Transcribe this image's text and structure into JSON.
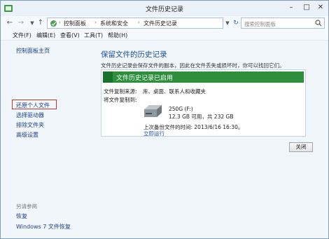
{
  "window": {
    "title": "文件历史记录"
  },
  "address": {
    "breadcrumbs": [
      "控制面板",
      "系统和安全",
      "文件历史记录"
    ]
  },
  "search": {
    "placeholder": "搜索控制面板"
  },
  "menu": [
    "文件(F)",
    "编辑(E)",
    "查看(V)",
    "工具(T)",
    "帮助(H)"
  ],
  "sidebar": {
    "home": "控制面板主页",
    "items": [
      "还原个人文件",
      "选择驱动器",
      "排除文件夹",
      "高级设置"
    ],
    "see_also_label": "另请参阅",
    "see_also": [
      "恢复",
      "Windows 7 文件恢复"
    ]
  },
  "main": {
    "heading": "保留文件的历史记录",
    "description": "文件历史记录会保存文件的副本，因此在文件丢失或损坏时，你可以找回它们。",
    "status": "文件历史记录已启用",
    "copy_from_label": "文件复制来源:",
    "copy_from_value": "库、桌面、联系人和收藏夹",
    "copy_to_label": "将文件复制到:",
    "drive_name": "250G (F:)",
    "drive_space": "12.3 GB 可用，共 232 GB",
    "last_backup": "上次备份文件的时间: 2013/6/16 16:30。",
    "run_now": "立即运行"
  },
  "buttons": {
    "close": "关闭"
  },
  "colors": {
    "accent_green": "#2d8f3b",
    "heading_blue": "#1b4f9a",
    "link_blue": "#1e3f8a",
    "highlight_red": "#c0392b"
  }
}
